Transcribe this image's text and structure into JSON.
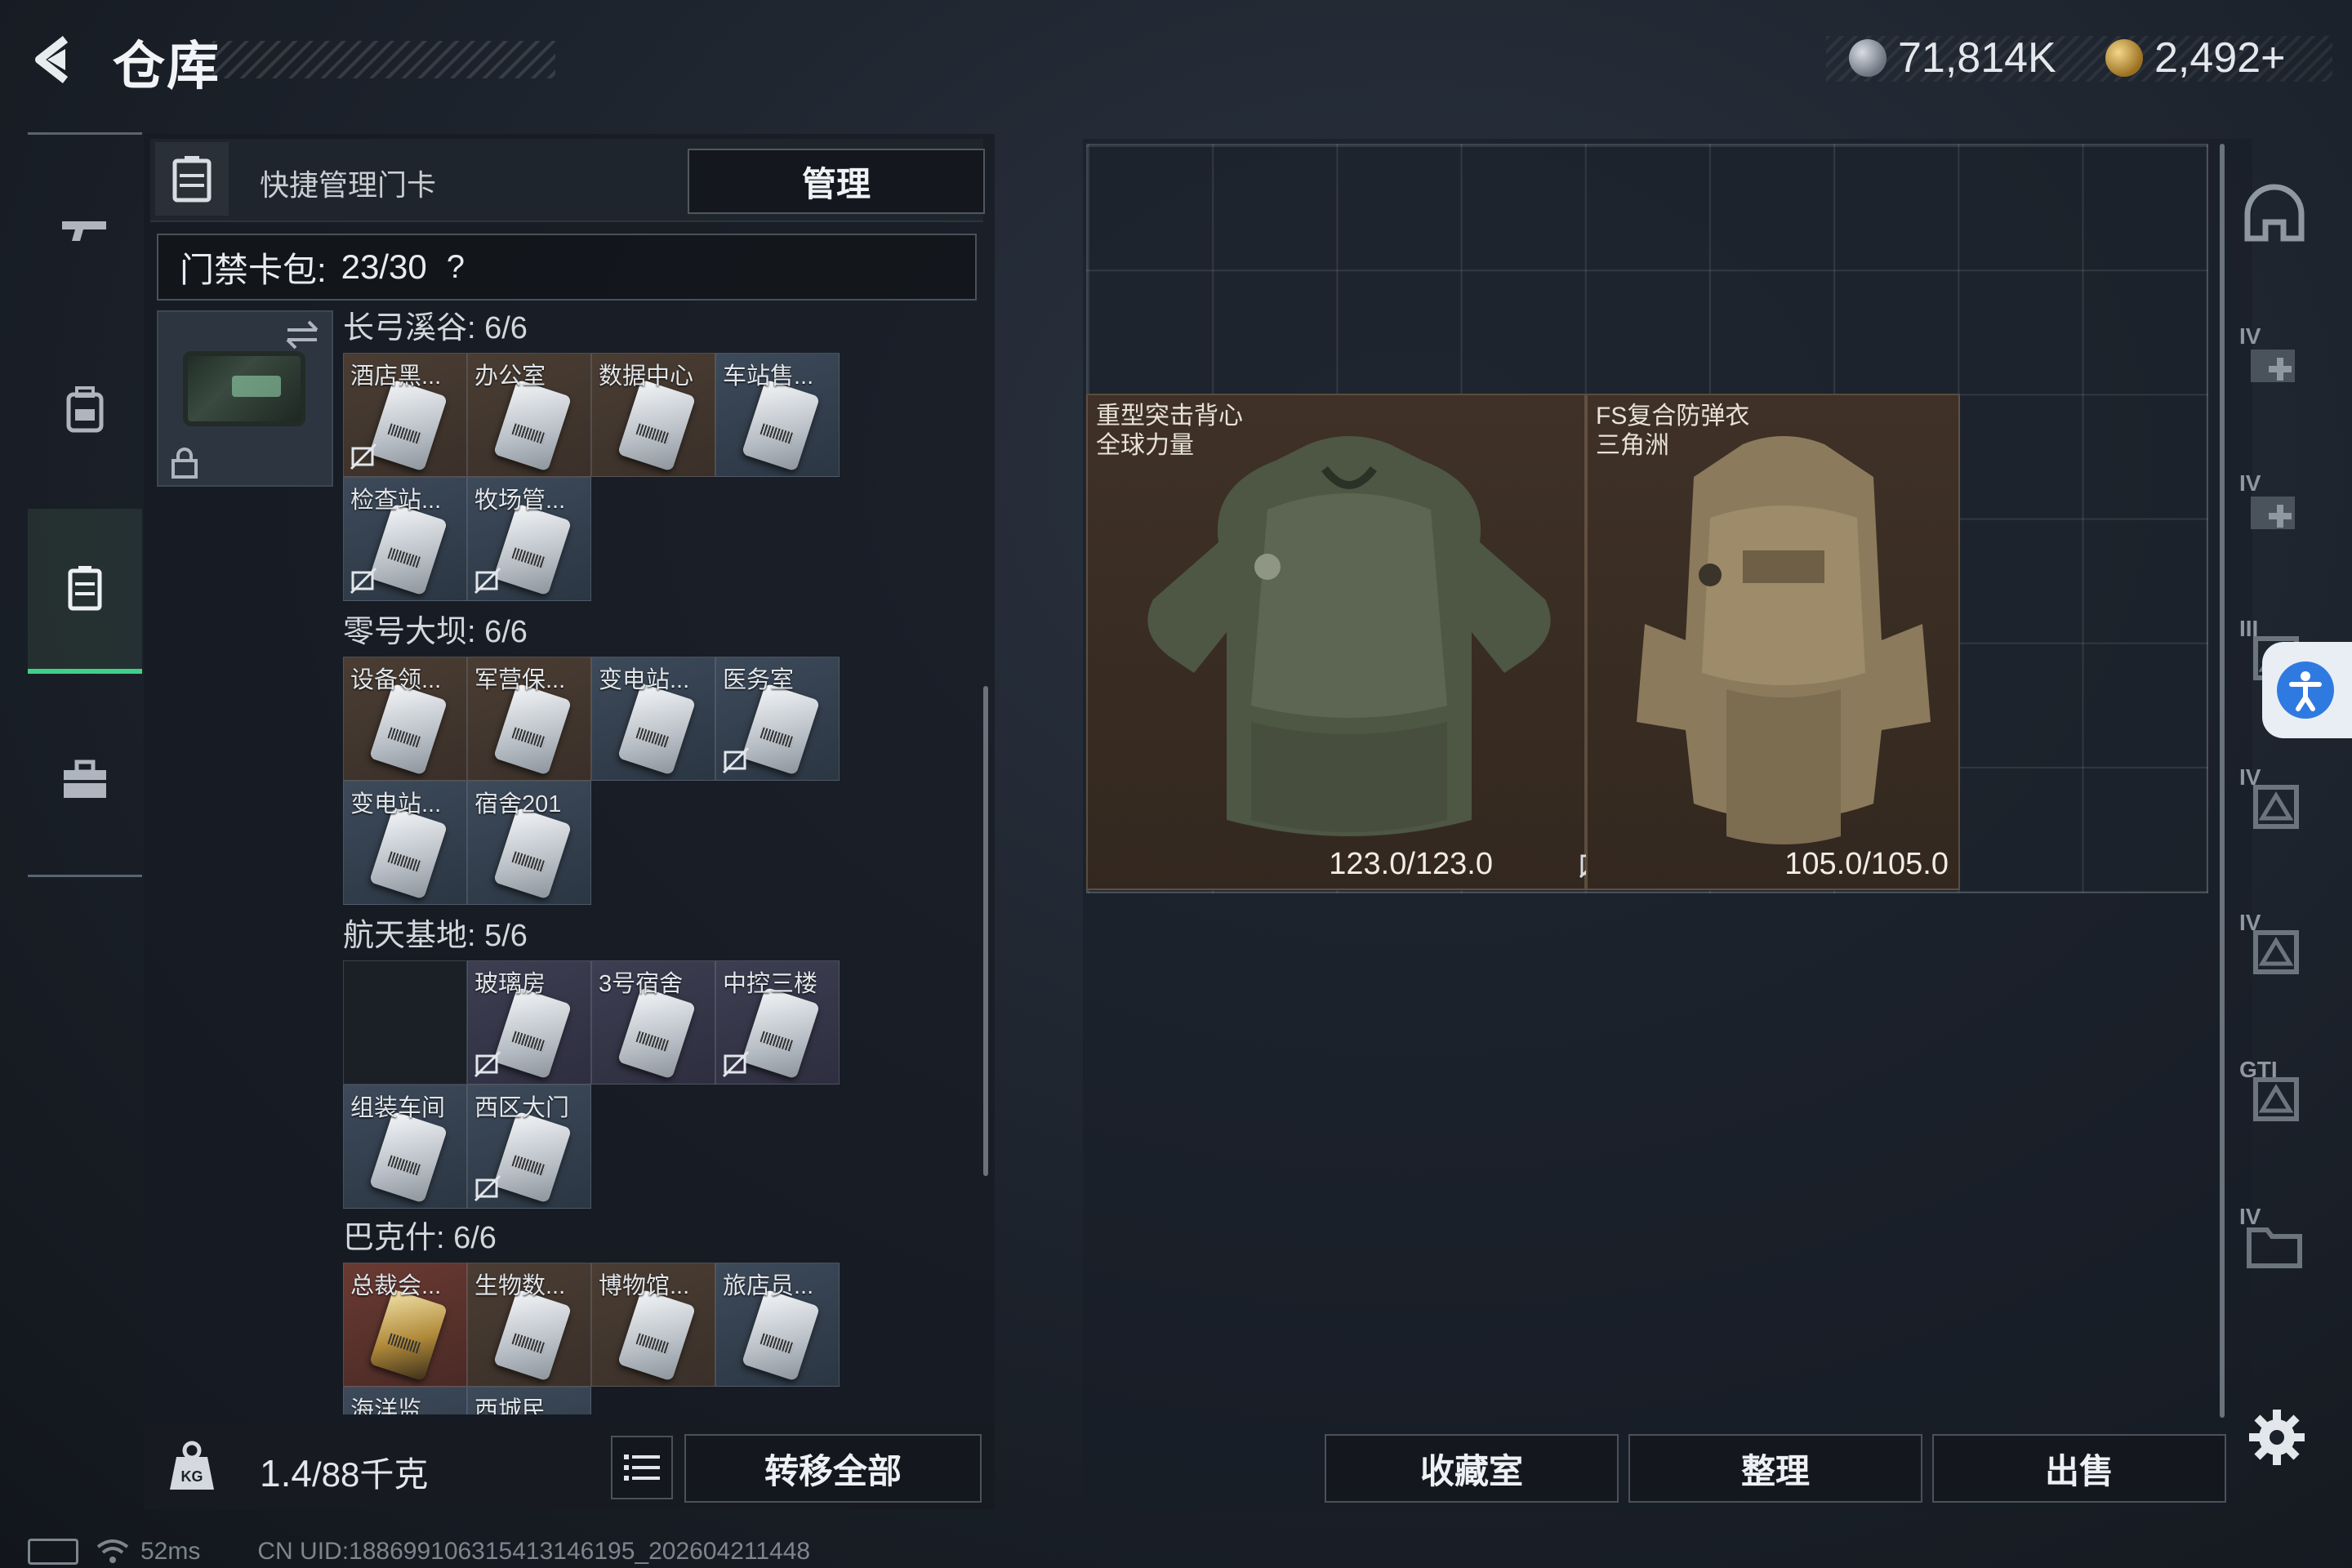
{
  "header": {
    "title": "仓库",
    "currency_silver": "71,814K",
    "currency_gold": "2,492+"
  },
  "left_nav": {
    "items": [
      {
        "icon": "gun-icon"
      },
      {
        "icon": "backpack-icon"
      },
      {
        "icon": "keycard-holder-icon",
        "active": true
      },
      {
        "icon": "toolbox-icon"
      }
    ]
  },
  "keycard_panel": {
    "quick_title": "快捷管理门卡",
    "manage_label": "管理",
    "pack_label": "门禁卡包:",
    "pack_count": "23/30",
    "pack_help": "?",
    "sections": [
      {
        "title": "长弓溪谷: 6/6",
        "cards": [
          {
            "label": "酒店黑...",
            "color": "brown",
            "nobind": true
          },
          {
            "label": "办公室",
            "color": "brown",
            "nobind": false
          },
          {
            "label": "数据中心",
            "color": "brown",
            "nobind": false
          },
          {
            "label": "车站售...",
            "color": "blue",
            "nobind": false
          },
          {
            "label": "检查站...",
            "color": "blue",
            "nobind": true
          },
          {
            "label": "牧场管...",
            "color": "blue",
            "nobind": true
          }
        ]
      },
      {
        "title": "零号大坝: 6/6",
        "cards": [
          {
            "label": "设备领...",
            "color": "brown",
            "nobind": false
          },
          {
            "label": "军营保...",
            "color": "brown",
            "nobind": false
          },
          {
            "label": "变电站...",
            "color": "blue",
            "nobind": false
          },
          {
            "label": "医务室",
            "color": "blue",
            "nobind": true
          },
          {
            "label": "变电站...",
            "color": "blue",
            "nobind": false
          },
          {
            "label": "宿舍201",
            "color": "blue",
            "nobind": false
          }
        ]
      },
      {
        "title": "航天基地: 5/6",
        "cards": [
          {
            "label": "",
            "color": "empty",
            "nobind": false
          },
          {
            "label": "玻璃房",
            "color": "purple",
            "nobind": true
          },
          {
            "label": "3号宿舍",
            "color": "purple",
            "nobind": false
          },
          {
            "label": "中控三楼",
            "color": "purple",
            "nobind": true
          },
          {
            "label": "组装车间",
            "color": "blue",
            "nobind": false
          },
          {
            "label": "西区大门",
            "color": "blue",
            "nobind": true
          }
        ]
      },
      {
        "title": "巴克什: 6/6",
        "cards": [
          {
            "label": "总裁会...",
            "color": "red",
            "nobind": false,
            "gold": true
          },
          {
            "label": "生物数...",
            "color": "brown",
            "nobind": false
          },
          {
            "label": "博物馆...",
            "color": "brown",
            "nobind": false
          },
          {
            "label": "旅店员...",
            "color": "blue",
            "nobind": false
          },
          {
            "label": "海洋监...",
            "color": "blue",
            "nobind": false
          },
          {
            "label": "西城民...",
            "color": "blue",
            "nobind": false
          }
        ]
      }
    ]
  },
  "bottom_left": {
    "weight_current": "1.4",
    "weight_rest": "/88千克",
    "transfer_label": "转移全部"
  },
  "status": {
    "ping": "52ms",
    "uid": "CN UID:1886991063154131461​95_202604211448"
  },
  "stash": {
    "items": [
      {
        "name_line1": "重型突击背心",
        "name_line2": "全球力量",
        "durability": "123.0/123.0",
        "nobind": true,
        "tone": "green"
      },
      {
        "name_line1": "FS复合防弹衣",
        "name_line2": "三角洲",
        "durability": "105.0/105.0",
        "nobind": false,
        "tone": "tan"
      }
    ]
  },
  "right_tabs": [
    {
      "tier": "",
      "icon": "helmet-icon"
    },
    {
      "tier": "IV",
      "icon": "medkit-icon"
    },
    {
      "tier": "IV",
      "icon": "medkit-icon"
    },
    {
      "tier": "III",
      "icon": "armor-icon"
    },
    {
      "tier": "IV",
      "icon": "armor-icon"
    },
    {
      "tier": "IV",
      "icon": "armor-icon"
    },
    {
      "tier": "GTI",
      "icon": "armor-icon"
    },
    {
      "tier": "IV",
      "icon": "folder-icon"
    }
  ],
  "bottom_right": {
    "collection_label": "收藏室",
    "sort_label": "整理",
    "sell_label": "出售"
  },
  "colors": {
    "accent_green": "#3fd18a",
    "access_blue": "#2f7ae0"
  }
}
